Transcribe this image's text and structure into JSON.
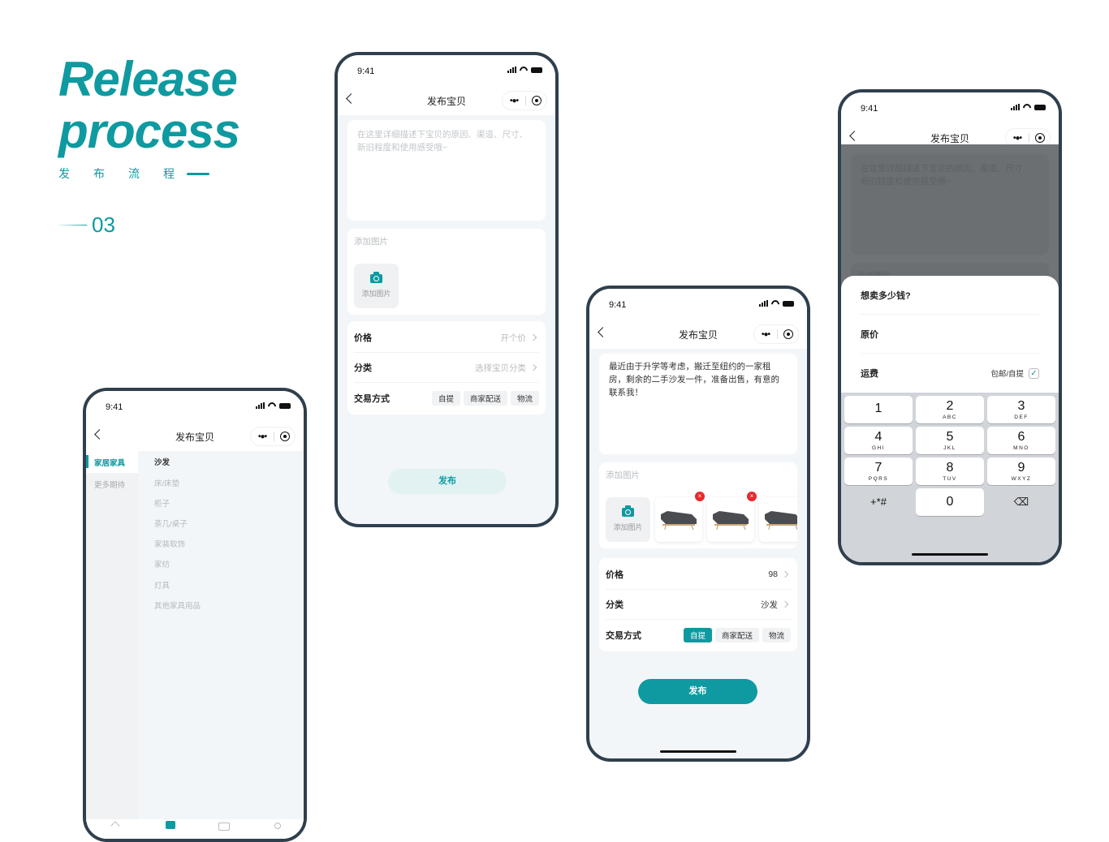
{
  "header": {
    "title_line1": "Release",
    "title_line2": "process",
    "subtitle_chars": [
      "发",
      "布",
      "流",
      "程"
    ],
    "step_number": "03"
  },
  "colors": {
    "accent": "#0e9aa0",
    "frame": "#2f3f4d",
    "delete": "#e8282d"
  },
  "common": {
    "time": "9:41",
    "page_title": "发布宝贝",
    "more_icon": "more-dots-icon",
    "record_icon": "target-icon"
  },
  "phone1": {
    "categories": [
      {
        "label": "家居家具",
        "active": true
      },
      {
        "label": "更多期待",
        "active": false
      }
    ],
    "subcategories": [
      {
        "label": "沙发",
        "active": true
      },
      {
        "label": "床/床垫"
      },
      {
        "label": "柜子"
      },
      {
        "label": "茶几/桌子"
      },
      {
        "label": "家装软饰"
      },
      {
        "label": "家纺"
      },
      {
        "label": "灯具"
      },
      {
        "label": "其他家具用品"
      }
    ],
    "tabbar_icons": [
      "home-icon",
      "publish-icon",
      "message-icon",
      "profile-icon"
    ]
  },
  "phone2": {
    "description_placeholder": "在这里详细描述下宝贝的原因、渠道、尺寸、新旧程度和使用感受哦~",
    "photos_label": "添加图片",
    "add_photo_label": "添加图片",
    "price_label": "价格",
    "price_placeholder": "开个价",
    "category_label": "分类",
    "category_placeholder": "选择宝贝分类",
    "trade_label": "交易方式",
    "trade_options": [
      "自提",
      "商家配送",
      "物流"
    ],
    "publish_label": "发布"
  },
  "phone3": {
    "description": "最近由于升学等考虑，搬迁至纽约的一家租房，剩余的二手沙发一件，准备出售，有意的联系我！",
    "photos_label": "添加图片",
    "add_photo_label": "添加图片",
    "photo_count": 3,
    "price_label": "价格",
    "price_value": "98",
    "category_label": "分类",
    "category_value": "沙发",
    "trade_label": "交易方式",
    "trade_options": [
      "自提",
      "商家配送",
      "物流"
    ],
    "trade_selected": "自提",
    "publish_label": "发布"
  },
  "phone4": {
    "description_placeholder": "在这里详细描述下宝贝的原因、渠道、尺寸、新旧程度和使用感受哦~",
    "photos_label": "添加图片",
    "sheet_title": "想卖多少钱?",
    "original_price_label": "原价",
    "shipping_label": "运费",
    "shipping_option": "包邮/自提",
    "shipping_checked": true,
    "keypad": [
      {
        "n": "1",
        "l": ""
      },
      {
        "n": "2",
        "l": "ABC"
      },
      {
        "n": "3",
        "l": "DEF"
      },
      {
        "n": "4",
        "l": "GHI"
      },
      {
        "n": "5",
        "l": "JKL"
      },
      {
        "n": "6",
        "l": "MNO"
      },
      {
        "n": "7",
        "l": "PQRS"
      },
      {
        "n": "8",
        "l": "TUV"
      },
      {
        "n": "9",
        "l": "WXYZ"
      }
    ],
    "key_symbols": "+*#",
    "key_zero": "0",
    "key_delete_icon": "backspace-icon"
  }
}
